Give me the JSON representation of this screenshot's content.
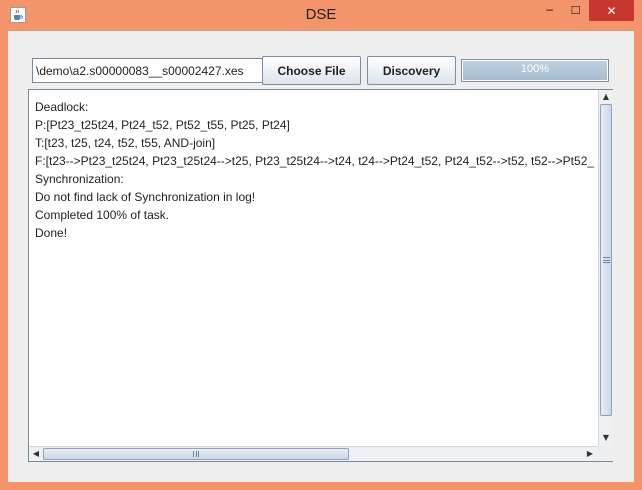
{
  "window": {
    "title": "DSE",
    "minimize_glyph": "─",
    "maximize_glyph": "☐",
    "close_glyph": "✕",
    "app_icon": "java-coffee-cup-icon"
  },
  "toolbar": {
    "file_path_value": "\\demo\\a2.s00000083__s00002427.xes",
    "choose_file_label": "Choose File",
    "discovery_label": "Discovery",
    "progress_text": "100%",
    "progress_fraction": 1.0
  },
  "log": {
    "lines": [
      "Deadlock:",
      "P:[Pt23_t25t24, Pt24_t52, Pt52_t55, Pt25, Pt24]",
      "T:[t23, t25, t24, t52, t55, AND-join]",
      "F:[t23-->Pt23_t25t24, Pt23_t25t24-->t25, Pt23_t25t24-->t24, t24-->Pt24_t52, Pt24_t52-->t52, t52-->Pt52_",
      "Synchronization:",
      "Do not find lack of Synchronization in log!",
      "Completed 100% of task.",
      "Done!"
    ]
  },
  "scrollbars": {
    "up_arrow": "▲",
    "down_arrow": "▼",
    "left_arrow": "◀",
    "right_arrow": "▶"
  },
  "colors": {
    "window_frame": "#f3946a",
    "close_button": "#c7362f",
    "panel_background": "#eeeeee"
  }
}
